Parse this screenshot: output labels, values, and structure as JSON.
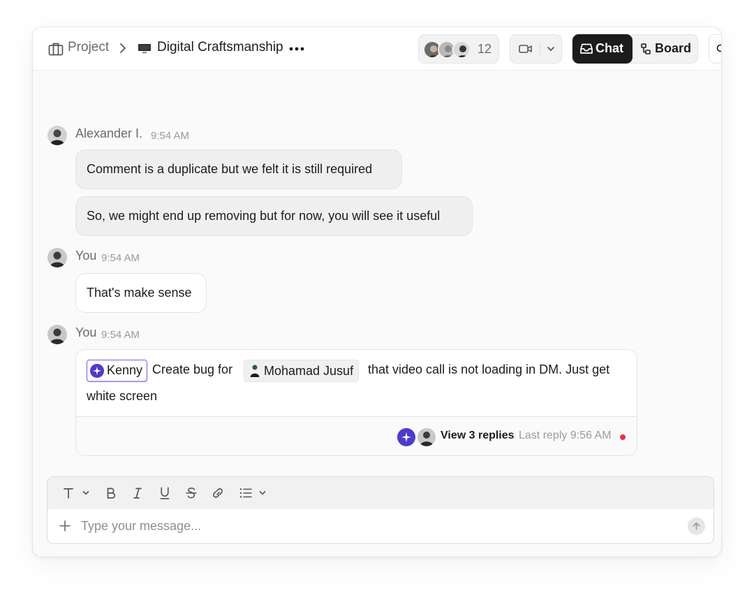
{
  "header": {
    "breadcrumb": {
      "project_label": "Project",
      "page_title": "Digital Craftsmanship",
      "project_icon": "briefcase-icon",
      "page_icon": "monitor-icon"
    },
    "members_count": "12",
    "tabs": {
      "chat_label": "Chat",
      "board_label": "Board",
      "active": "Chat"
    }
  },
  "messages": [
    {
      "author": "Alexander I.",
      "time": "9:54 AM",
      "bubbles": [
        "Comment is a duplicate but we felt it is still required",
        "So, we might end up removing but for now, you will see it useful"
      ]
    },
    {
      "author": "You",
      "time": "9:54 AM",
      "bubbles": [
        "That's make sense"
      ]
    },
    {
      "author": "You",
      "time": "9:54 AM",
      "card": {
        "mention_bot": "Kenny",
        "text_a": "Create bug for",
        "mention_user": "Mohamad Jusuf",
        "text_b": "that video call is not loading in DM. Just get",
        "text_c": "white screen",
        "view_replies": "View 3 replies",
        "last_reply": "Last reply 9:56 AM"
      }
    }
  ],
  "composer": {
    "placeholder": "Type your message..."
  },
  "colors": {
    "accent_dark": "#1c1c1e",
    "bot_purple": "#4c3ccc",
    "mention_border": "#7c5cf0",
    "unread_red": "#e5343d"
  }
}
